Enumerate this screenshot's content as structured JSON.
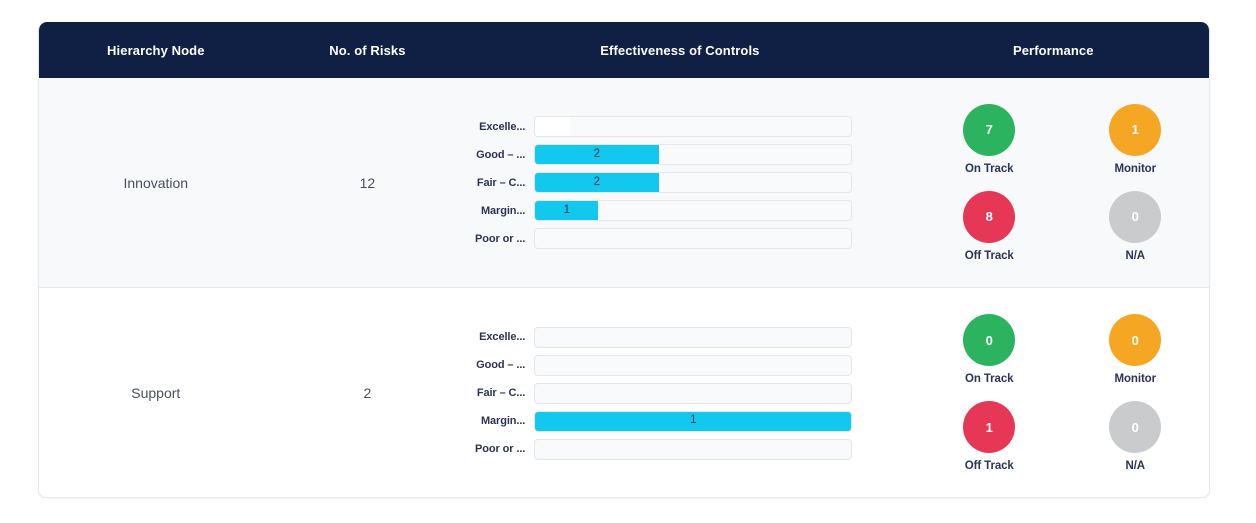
{
  "table": {
    "columns": [
      {
        "key": "node",
        "label": "Hierarchy Node"
      },
      {
        "key": "risks",
        "label": "No. of Risks"
      },
      {
        "key": "controls",
        "label": "Effectiveness of Controls"
      },
      {
        "key": "performance",
        "label": "Performance"
      }
    ],
    "header_background": "#101f44",
    "header_text_color": "#ffffff"
  },
  "colors": {
    "bar_fill": "#12c8ec",
    "bar_track": "#f9fafb",
    "on_track": "#2cb35f",
    "monitor": "#f5a623",
    "off_track": "#e63757",
    "na": "#c9cbcd",
    "row_alt_background": "#f8f9fb",
    "row_background": "#ffffff"
  },
  "control_categories": [
    "Excelle...",
    "Good – ...",
    "Fair – C...",
    "Margin...",
    "Poor or ..."
  ],
  "performance_labels": {
    "on_track": "On Track",
    "monitor": "Monitor",
    "off_track": "Off Track",
    "na": "N/A"
  },
  "rows": [
    {
      "node": "Innovation",
      "risks": "12",
      "controls": [
        {
          "category": "Excelle...",
          "value": "",
          "pct": 11,
          "white": true
        },
        {
          "category": "Good – ...",
          "value": "2",
          "pct": 39,
          "white": false
        },
        {
          "category": "Fair – C...",
          "value": "2",
          "pct": 39,
          "white": false
        },
        {
          "category": "Margin...",
          "value": "1",
          "pct": 20,
          "white": false
        },
        {
          "category": "Poor or ...",
          "value": "",
          "pct": 0,
          "white": false
        }
      ],
      "performance": {
        "on_track": "7",
        "monitor": "1",
        "off_track": "8",
        "na": "0"
      }
    },
    {
      "node": "Support",
      "risks": "2",
      "controls": [
        {
          "category": "Excelle...",
          "value": "",
          "pct": 0,
          "white": false
        },
        {
          "category": "Good – ...",
          "value": "",
          "pct": 0,
          "white": false
        },
        {
          "category": "Fair – C...",
          "value": "",
          "pct": 0,
          "white": false
        },
        {
          "category": "Margin...",
          "value": "1",
          "pct": 100,
          "white": false
        },
        {
          "category": "Poor or ...",
          "value": "",
          "pct": 0,
          "white": false
        }
      ],
      "performance": {
        "on_track": "0",
        "monitor": "0",
        "off_track": "1",
        "na": "0"
      }
    }
  ],
  "chart_data": {
    "type": "bar",
    "title": "Effectiveness of Controls",
    "orientation": "horizontal",
    "categories": [
      "Excelle...",
      "Good – ...",
      "Fair – C...",
      "Margin...",
      "Poor or ..."
    ],
    "series": [
      {
        "name": "Innovation",
        "values": [
          0,
          2,
          2,
          1,
          0
        ]
      },
      {
        "name": "Support",
        "values": [
          0,
          0,
          0,
          1,
          0
        ]
      }
    ],
    "xlabel": "",
    "ylabel": "",
    "grid": false,
    "legend": "none"
  }
}
